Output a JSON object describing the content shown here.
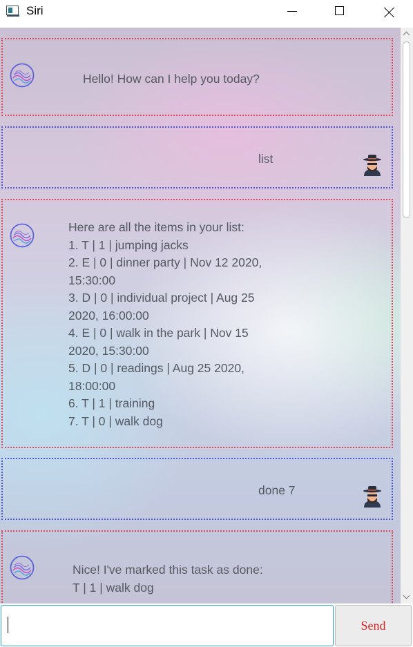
{
  "window": {
    "title": "Siri",
    "icons": {
      "app": "app-window-icon",
      "minimize": "minimize-icon",
      "maximize": "maximize-icon",
      "close": "close-icon"
    }
  },
  "conversation": [
    {
      "sender": "siri",
      "text": "Hello! How can I help you today?"
    },
    {
      "sender": "user",
      "text": "list"
    },
    {
      "sender": "siri",
      "text": "Here are all the items in your list:\n1. T | 1 | jumping jacks\n2. E | 0 | dinner party | Nov 12 2020,\n15:30:00\n3. D | 0 | individual project | Aug 25\n2020, 16:00:00\n4. E | 0 | walk in the park | Nov 15\n2020, 15:30:00\n5. D | 0 | readings | Aug 25 2020,\n18:00:00\n6. T | 1 | training\n7. T | 0 | walk dog"
    },
    {
      "sender": "user",
      "text": "done 7"
    },
    {
      "sender": "siri",
      "text": "Nice! I've marked this task as done:\nT | 1 | walk dog"
    }
  ],
  "colors": {
    "siri_border": "#e0455a",
    "user_border": "#4c55d8",
    "send_text": "#d62424",
    "input_focus": "#2aa1d6"
  },
  "input": {
    "value": "",
    "placeholder": ""
  },
  "send": {
    "label": "Send"
  }
}
